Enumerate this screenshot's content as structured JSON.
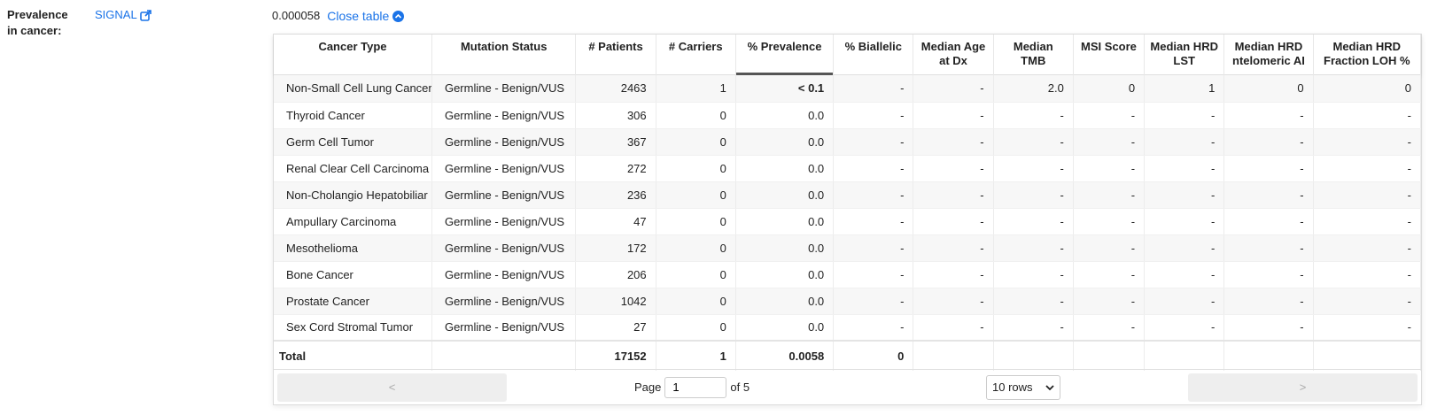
{
  "label": {
    "line1": "Prevalence",
    "line2": "in cancer:"
  },
  "signal": {
    "text": "SIGNAL",
    "icon": "external-link-icon"
  },
  "summary": {
    "value": "0.000058",
    "close_label": "Close table"
  },
  "colors": {
    "link": "#1a73e8"
  },
  "table": {
    "headers": [
      [
        "Cancer Type"
      ],
      [
        "Mutation Status"
      ],
      [
        "# Patients"
      ],
      [
        "# Carriers"
      ],
      [
        "% Prevalence"
      ],
      [
        "% Biallelic"
      ],
      [
        "Median Age",
        "at Dx"
      ],
      [
        "Median",
        "TMB"
      ],
      [
        "MSI Score"
      ],
      [
        "Median HRD",
        "LST"
      ],
      [
        "Median HRD",
        "ntelomeric AI"
      ],
      [
        "Median HRD",
        "Fraction LOH %"
      ]
    ],
    "rows": [
      [
        "Non-Small Cell Lung Cancer",
        "Germline - Benign/VUS",
        "2463",
        "1",
        "< 0.1",
        "-",
        "-",
        "2.0",
        "0",
        "1",
        "0",
        "0"
      ],
      [
        "Thyroid Cancer",
        "Germline - Benign/VUS",
        "306",
        "0",
        "0.0",
        "-",
        "-",
        "-",
        "-",
        "-",
        "-",
        "-"
      ],
      [
        "Germ Cell Tumor",
        "Germline - Benign/VUS",
        "367",
        "0",
        "0.0",
        "-",
        "-",
        "-",
        "-",
        "-",
        "-",
        "-"
      ],
      [
        "Renal Clear Cell Carcinoma",
        "Germline - Benign/VUS",
        "272",
        "0",
        "0.0",
        "-",
        "-",
        "-",
        "-",
        "-",
        "-",
        "-"
      ],
      [
        "Non-Cholangio Hepatobiliar",
        "Germline - Benign/VUS",
        "236",
        "0",
        "0.0",
        "-",
        "-",
        "-",
        "-",
        "-",
        "-",
        "-"
      ],
      [
        "Ampullary Carcinoma",
        "Germline - Benign/VUS",
        "47",
        "0",
        "0.0",
        "-",
        "-",
        "-",
        "-",
        "-",
        "-",
        "-"
      ],
      [
        "Mesothelioma",
        "Germline - Benign/VUS",
        "172",
        "0",
        "0.0",
        "-",
        "-",
        "-",
        "-",
        "-",
        "-",
        "-"
      ],
      [
        "Bone Cancer",
        "Germline - Benign/VUS",
        "206",
        "0",
        "0.0",
        "-",
        "-",
        "-",
        "-",
        "-",
        "-",
        "-"
      ],
      [
        "Prostate Cancer",
        "Germline - Benign/VUS",
        "1042",
        "0",
        "0.0",
        "-",
        "-",
        "-",
        "-",
        "-",
        "-",
        "-"
      ],
      [
        "Sex Cord Stromal Tumor",
        "Germline - Benign/VUS",
        "27",
        "0",
        "0.0",
        "-",
        "-",
        "-",
        "-",
        "-",
        "-",
        "-"
      ]
    ],
    "total": [
      "Total",
      "",
      "17152",
      "1",
      "0.0058",
      "0",
      "",
      "",
      "",
      "",
      "",
      ""
    ]
  },
  "pager": {
    "prev": "<",
    "next": ">",
    "page_label": "Page",
    "page_value": "1",
    "of_label": "of 5",
    "rows_option": "10 rows"
  }
}
